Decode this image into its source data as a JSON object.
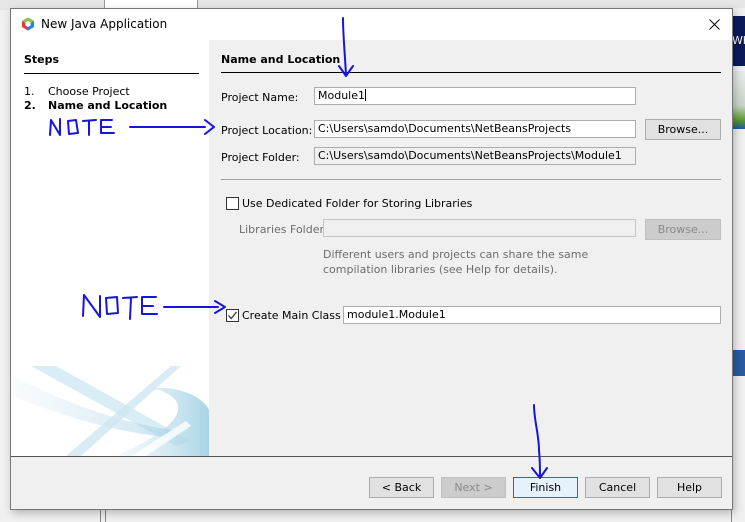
{
  "window": {
    "title": "New Java Application",
    "close_icon": "close-icon",
    "app_icon": "netbeans-cube-icon"
  },
  "background": {
    "partial_text": "Wh"
  },
  "steps": {
    "title": "Steps",
    "items": [
      {
        "num": "1.",
        "label": "Choose Project",
        "current": false
      },
      {
        "num": "2.",
        "label": "Name and Location",
        "current": true
      }
    ]
  },
  "content": {
    "section_title": "Name and Location",
    "project_name": {
      "label": "Project Name:",
      "value": "Module1"
    },
    "project_location": {
      "label": "Project Location:",
      "value": "C:\\Users\\samdo\\Documents\\NetBeansProjects",
      "browse": "Browse..."
    },
    "project_folder": {
      "label": "Project Folder:",
      "value": "C:\\Users\\samdo\\Documents\\NetBeansProjects\\Module1"
    },
    "dedicated_folder": {
      "label": "Use Dedicated Folder for Storing Libraries",
      "checked": false
    },
    "libraries_folder": {
      "label": "Libraries Folder:",
      "value": "",
      "browse": "Browse..."
    },
    "hint": "Different users and projects can share the same compilation libraries (see Help for details).",
    "create_main_class": {
      "label": "Create Main Class",
      "checked": true,
      "value": "module1.Module1"
    }
  },
  "buttons": {
    "back": "< Back",
    "next": "Next >",
    "finish": "Finish",
    "cancel": "Cancel",
    "help": "Help"
  },
  "annotations": {
    "note1": "NOTE",
    "note2": "NOTE",
    "ink_color": "#1515e0"
  },
  "colors": {
    "default_button_border": "#0078d7",
    "default_button_bg": "#e5f1fb"
  }
}
